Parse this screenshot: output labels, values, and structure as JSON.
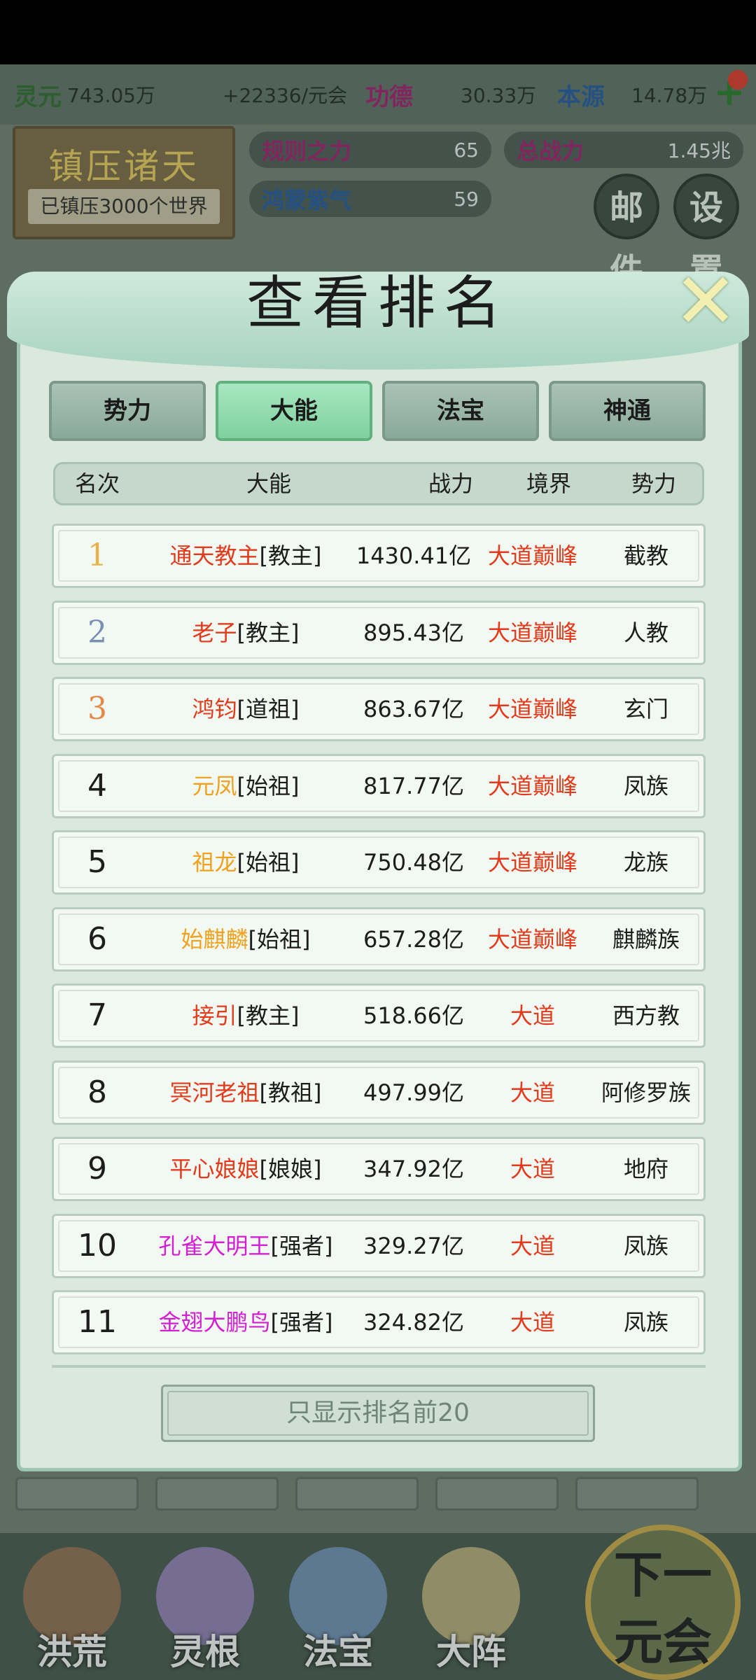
{
  "hud": {
    "lingyuan_label": "灵元",
    "lingyuan_value": "743.05万",
    "rate": "+22336/元会",
    "gongde_label": "功德",
    "gongde_value": "30.33万",
    "benyuan_label": "本源",
    "benyuan_value": "14.78万",
    "guize_label": "规则之力",
    "guize_value": "65",
    "zongzhanli_label": "总战力",
    "zongzhanli_value": "1.45兆",
    "hongmeng_label": "鸿蒙紫气",
    "hongmeng_value": "59",
    "suppress_title": "镇压诸天",
    "suppress_sub": "已镇压3000个世界",
    "mail_label": "邮件",
    "settings_label": "设置"
  },
  "modal": {
    "title": "查看排名",
    "tabs": [
      "势力",
      "大能",
      "法宝",
      "神通"
    ],
    "active_tab": "大能",
    "columns": [
      "名次",
      "大能",
      "战力",
      "境界",
      "势力"
    ],
    "rows": [
      {
        "rank": "1",
        "name": "通天教主",
        "title": "[教主]",
        "power": "1430.41亿",
        "realm": "大道巅峰",
        "faction": "截教",
        "name_color": "#e23a1b"
      },
      {
        "rank": "2",
        "name": "老子",
        "title": "[教主]",
        "power": "895.43亿",
        "realm": "大道巅峰",
        "faction": "人教",
        "name_color": "#e23a1b"
      },
      {
        "rank": "3",
        "name": "鸿钧",
        "title": "[道祖]",
        "power": "863.67亿",
        "realm": "大道巅峰",
        "faction": "玄门",
        "name_color": "#e23a1b"
      },
      {
        "rank": "4",
        "name": "元凤",
        "title": "[始祖]",
        "power": "817.77亿",
        "realm": "大道巅峰",
        "faction": "凤族",
        "name_color": "#f0a21e"
      },
      {
        "rank": "5",
        "name": "祖龙",
        "title": "[始祖]",
        "power": "750.48亿",
        "realm": "大道巅峰",
        "faction": "龙族",
        "name_color": "#f0a21e"
      },
      {
        "rank": "6",
        "name": "始麒麟",
        "title": "[始祖]",
        "power": "657.28亿",
        "realm": "大道巅峰",
        "faction": "麒麟族",
        "name_color": "#f0a21e"
      },
      {
        "rank": "7",
        "name": "接引",
        "title": "[教主]",
        "power": "518.66亿",
        "realm": "大道",
        "faction": "西方教",
        "name_color": "#e23a1b"
      },
      {
        "rank": "8",
        "name": "冥河老祖",
        "title": "[教祖]",
        "power": "497.99亿",
        "realm": "大道",
        "faction": "阿修罗族",
        "name_color": "#e23a1b"
      },
      {
        "rank": "9",
        "name": "平心娘娘",
        "title": "[娘娘]",
        "power": "347.92亿",
        "realm": "大道",
        "faction": "地府",
        "name_color": "#e23a1b"
      },
      {
        "rank": "10",
        "name": "孔雀大明王",
        "title": "[强者]",
        "power": "329.27亿",
        "realm": "大道",
        "faction": "凤族",
        "name_color": "#d21fd2"
      },
      {
        "rank": "11",
        "name": "金翅大鹏鸟",
        "title": "[强者]",
        "power": "324.82亿",
        "realm": "大道",
        "faction": "凤族",
        "name_color": "#d21fd2"
      }
    ],
    "bottom_button": "只显示排名前20"
  },
  "nav": {
    "items": [
      "洪荒",
      "灵根",
      "法宝",
      "大阵"
    ],
    "next_line1": "下一",
    "next_line2": "元会"
  }
}
